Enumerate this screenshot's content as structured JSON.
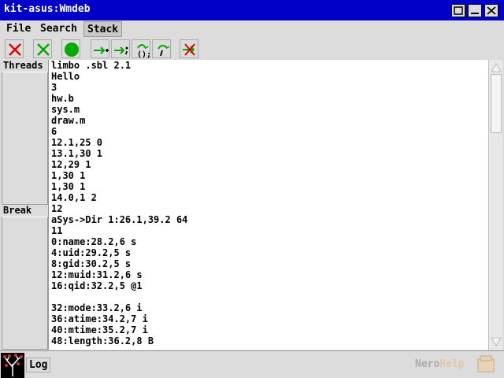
{
  "window": {
    "title": "kit-asus:Wmdeb"
  },
  "menu": {
    "file": "File",
    "search": "Search",
    "stack": "Stack"
  },
  "left_pane": {
    "threads_label": "Threads",
    "break_label": "Break"
  },
  "lines": [
    "limbo .sbl 2.1",
    "Hello",
    "3",
    "hw.b",
    "sys.m",
    "draw.m",
    "6",
    "12.1,25 0",
    "13.1,30 1",
    "12,29 1",
    "1,30 1",
    "1,30 1",
    "14.0,1 2",
    "12",
    "aSys->Dir 1:26.1,39.2 64",
    "11",
    "0:name:28.2,6 s",
    "4:uid:29.2,5 s",
    "8:gid:30.2,5 s",
    "12:muid:31.2,6 s",
    "16:qid:32.2,5 @1",
    "",
    "32:mode:33.2,6 i",
    "36:atime:34.2,7 i",
    "40:mtime:35.2,7 i",
    "48:length:36.2,8 B"
  ],
  "status": {
    "log_label": "Log",
    "brand_nero": "Nero",
    "brand_help": "Help"
  },
  "colors": {
    "titlebar": "#0000c8",
    "stop_red": "#e00000",
    "run_green": "#00aa00"
  },
  "icons": [
    "kill-icon",
    "exit-icon",
    "run-icon",
    "step-into-icon",
    "step-over-icon",
    "step-out-icon",
    "return-icon",
    "clear-breakpoint-icon"
  ]
}
